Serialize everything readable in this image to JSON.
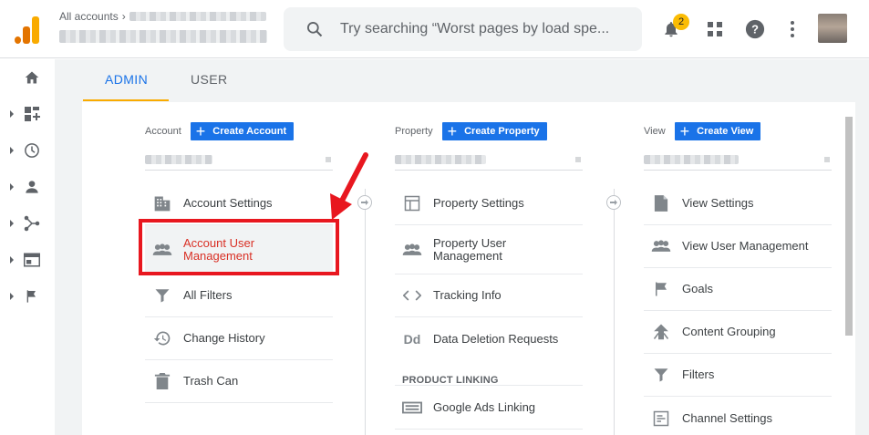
{
  "header": {
    "breadcrumb": "All accounts",
    "search_placeholder": "Try searching “Worst pages by load spe...",
    "notification_count": "2"
  },
  "sidenav": {
    "items": [
      {
        "icon": "home-icon"
      },
      {
        "icon": "customization-icon"
      },
      {
        "icon": "realtime-clock-icon"
      },
      {
        "icon": "audience-person-icon"
      },
      {
        "icon": "acquisition-icon"
      },
      {
        "icon": "behavior-icon"
      },
      {
        "icon": "conversions-flag-icon"
      }
    ]
  },
  "tabs": [
    {
      "label": "ADMIN",
      "active": true
    },
    {
      "label": "USER",
      "active": false
    }
  ],
  "columns": {
    "account": {
      "label": "Account",
      "create_label": "Create Account",
      "items": [
        {
          "label": "Account Settings",
          "icon": "building-icon"
        },
        {
          "label": "Account User\nManagement",
          "icon": "people-icon",
          "highlighted": true
        },
        {
          "label": "All Filters",
          "icon": "filter-icon"
        },
        {
          "label": "Change History",
          "icon": "history-icon"
        },
        {
          "label": "Trash Can",
          "icon": "trash-icon"
        }
      ]
    },
    "property": {
      "label": "Property",
      "create_label": "Create Property",
      "items": [
        {
          "label": "Property Settings",
          "icon": "property-window-icon"
        },
        {
          "label": "Property User\nManagement",
          "icon": "people-icon"
        },
        {
          "label": "Tracking Info",
          "icon": "code-icon"
        },
        {
          "label": "Data Deletion Requests",
          "icon": "dd-icon"
        }
      ],
      "section_label": "PRODUCT LINKING",
      "linking_items": [
        {
          "label": "Google Ads Linking",
          "icon": "ads-linking-icon"
        }
      ]
    },
    "view": {
      "label": "View",
      "create_label": "Create View",
      "items": [
        {
          "label": "View Settings",
          "icon": "document-icon"
        },
        {
          "label": "View User Management",
          "icon": "people-icon"
        },
        {
          "label": "Goals",
          "icon": "flag-icon"
        },
        {
          "label": "Content Grouping",
          "icon": "grouping-icon"
        },
        {
          "label": "Filters",
          "icon": "filter-icon"
        },
        {
          "label": "Channel Settings",
          "icon": "channel-settings-icon"
        }
      ]
    }
  },
  "colors": {
    "accent": "#1a73e8",
    "highlight": "#e8171f",
    "tab_underline": "#f9ab00"
  }
}
